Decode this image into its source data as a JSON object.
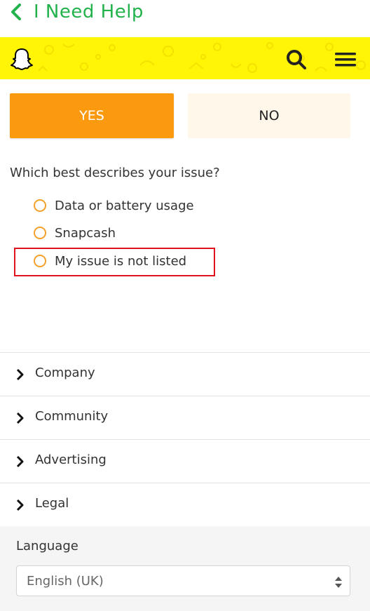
{
  "header": {
    "title": "I Need Help",
    "back_icon": "chevron-left-icon",
    "brand_color": "#22b24c"
  },
  "brand_bar": {
    "logo_icon": "snapchat-ghost-icon",
    "search_icon": "search-icon",
    "menu_icon": "hamburger-menu-icon",
    "color": "#fff505"
  },
  "feedback": {
    "yes_label": "YES",
    "no_label": "NO",
    "yes_color": "#fc9a0f"
  },
  "question": {
    "text": "Which best describes your issue?",
    "options": [
      {
        "label": "Data or battery usage"
      },
      {
        "label": "Snapcash"
      },
      {
        "label": "My issue is not listed"
      }
    ]
  },
  "footer": {
    "items": [
      {
        "label": "Company"
      },
      {
        "label": "Community"
      },
      {
        "label": "Advertising"
      },
      {
        "label": "Legal"
      }
    ]
  },
  "language": {
    "label": "Language",
    "selected": "English (UK)"
  }
}
